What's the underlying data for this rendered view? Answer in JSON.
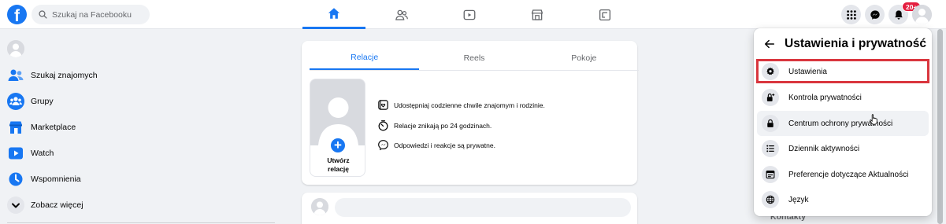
{
  "colors": {
    "brand": "#1877f2",
    "highlight": "#d9363e",
    "badge": "#e41e3f"
  },
  "topbar": {
    "logo_letter": "f",
    "search": {
      "placeholder": "Szukaj na Facebooku",
      "icon": "search-icon"
    },
    "nav_tabs": [
      {
        "icon": "home-icon",
        "active": true
      },
      {
        "icon": "friends-icon",
        "active": false
      },
      {
        "icon": "watch-icon",
        "active": false
      },
      {
        "icon": "marketplace-icon",
        "active": false
      },
      {
        "icon": "gaming-icon",
        "active": false
      }
    ],
    "right": {
      "menu_icon": "grid-menu-icon",
      "messenger_icon": "messenger-icon",
      "notifications_icon": "bell-icon",
      "notifications_badge": "20+",
      "account_icon": "avatar"
    }
  },
  "sidebar": {
    "items": [
      {
        "label": "Szukaj znajomych",
        "icon": "friends-icon"
      },
      {
        "label": "Grupy",
        "icon": "groups-icon"
      },
      {
        "label": "Marketplace",
        "icon": "marketplace-icon"
      },
      {
        "label": "Watch",
        "icon": "watch-icon"
      },
      {
        "label": "Wspomnienia",
        "icon": "memories-icon"
      },
      {
        "label": "Zobacz więcej",
        "icon": "chevron-down-icon"
      }
    ]
  },
  "stories": {
    "tabs": [
      {
        "label": "Relacje",
        "active": true
      },
      {
        "label": "Reels",
        "active": false
      },
      {
        "label": "Pokoje",
        "active": false
      }
    ],
    "create": {
      "label": "Utwórz relację",
      "plus": "+"
    },
    "features": [
      {
        "text": "Udostępniaj codzienne chwile znajomym i rodzinie.",
        "icon": "story-icon"
      },
      {
        "text": "Relacje znikają po 24 godzinach.",
        "icon": "timer-icon"
      },
      {
        "text": "Odpowiedzi i reakcje są prywatne.",
        "icon": "messenger-icon"
      }
    ]
  },
  "contacts": {
    "label": "Kontakty"
  },
  "settings_menu": {
    "title": "Ustawienia i prywatność",
    "items": [
      {
        "label": "Ustawienia",
        "icon": "gear-icon",
        "highlighted": true
      },
      {
        "label": "Kontrola prywatności",
        "icon": "lock-plus-icon"
      },
      {
        "label": "Centrum ochrony prywatności",
        "icon": "lock-icon",
        "hover": true
      },
      {
        "label": "Dziennik aktywności",
        "icon": "list-icon"
      },
      {
        "label": "Preferencje dotyczące Aktualności",
        "icon": "feed-icon"
      },
      {
        "label": "Język",
        "icon": "globe-icon"
      }
    ]
  }
}
